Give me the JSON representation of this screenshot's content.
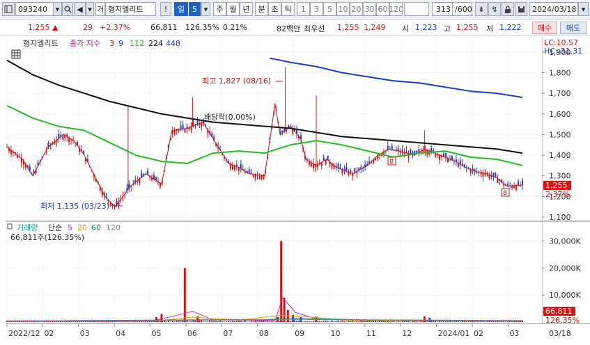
{
  "toolbar": {
    "code": "093240",
    "stock_tag": "거",
    "stock_name": "형지엘리트",
    "period_label": "일",
    "period_value": "5",
    "tabs": [
      "주",
      "월",
      "년",
      "분",
      "초",
      "틱"
    ],
    "intervals": [
      "1",
      "3",
      "5",
      "10",
      "20",
      "30",
      "60",
      "120"
    ],
    "page_count": "313",
    "page_total": "/600",
    "date": "2024/03/18"
  },
  "quote": {
    "price": "1,255",
    "change": "29",
    "change_pct": "+2.37%",
    "volume": "66,811",
    "volume_ratio": "126.35%",
    "turnover": "0.21%",
    "amount": "82백만",
    "best_label": "최우선",
    "best_ask": "1,255",
    "best_bid": "1,249",
    "open_label": "시",
    "open": "1,223",
    "high_label": "고",
    "high": "1,255",
    "low_label": "저",
    "low": "1,222",
    "buy_label": "매수",
    "sell_label": "매도"
  },
  "price_panel": {
    "stock_name": "형지엘리트",
    "ma_label": "종가 지수",
    "ma_periods": [
      "3",
      "9",
      "112",
      "224",
      "448"
    ],
    "ma_colors": [
      "#d01010",
      "#1a3cd0",
      "#20c020",
      "#101010",
      "#1a3cd0"
    ],
    "lc": "LC:10.57",
    "hc": "HC:-31.31",
    "high_annotation": "최고 1,827 (08/16)",
    "low_annotation": "최저 1,135 (03/23)",
    "dividend_annotation": "배당락(0.00%)",
    "price_tag": "1,255",
    "pct_tag": "2.37%",
    "ticks": [
      "1,900",
      "1,800",
      "1,700",
      "1,600",
      "1,500",
      "1,400",
      "1,300",
      "1,200",
      "1,100"
    ]
  },
  "volume_panel": {
    "title": "거래량",
    "ma_label": "단순",
    "ma_periods": [
      "5",
      "20",
      "60",
      "120"
    ],
    "ma_colors": [
      "#d020c0",
      "#e0a000",
      "#008060",
      "#808080"
    ],
    "summary": "66,811주(126.35%)",
    "ticks": [
      "30,000K",
      "20,000K",
      "10,000K"
    ],
    "volume_tag": "66,811",
    "pct_tag": "126.35%"
  },
  "x_axis": {
    "labels": [
      "2022/12",
      "02",
      "03",
      "04",
      "05",
      "06",
      "07",
      "08",
      "09",
      "10",
      "11",
      "12",
      "2024/01",
      "02",
      "03"
    ],
    "right_label": "03/18"
  },
  "chart_data": {
    "type": "line",
    "title": "형지엘리트",
    "x": [
      "2022/12",
      "02",
      "03",
      "04",
      "05",
      "06",
      "07",
      "08",
      "09",
      "10",
      "11",
      "12",
      "2024/01",
      "02",
      "03"
    ],
    "ylim": [
      1100,
      1950
    ],
    "series": [
      {
        "name": "3",
        "x_frac": [
          0.0,
          0.03,
          0.05,
          0.08,
          0.11,
          0.13,
          0.15,
          0.19,
          0.21,
          0.24,
          0.27,
          0.3,
          0.32,
          0.35,
          0.38,
          0.4,
          0.43,
          0.45,
          0.47,
          0.5,
          0.52,
          0.53,
          0.55,
          0.57,
          0.58,
          0.6,
          0.62,
          0.64,
          0.67,
          0.7,
          0.72,
          0.74,
          0.76,
          0.79,
          0.81,
          0.83,
          0.85,
          0.87,
          0.89,
          0.91,
          0.93,
          0.95,
          0.97,
          1.0
        ],
        "values": [
          1440,
          1380,
          1300,
          1440,
          1500,
          1470,
          1400,
          1200,
          1150,
          1250,
          1310,
          1260,
          1520,
          1530,
          1560,
          1480,
          1360,
          1340,
          1310,
          1300,
          1650,
          1500,
          1540,
          1480,
          1380,
          1350,
          1380,
          1340,
          1310,
          1350,
          1400,
          1430,
          1420,
          1400,
          1430,
          1410,
          1390,
          1370,
          1340,
          1320,
          1310,
          1290,
          1250,
          1255
        ]
      },
      {
        "name": "112",
        "x_frac": [
          0.0,
          0.05,
          0.1,
          0.15,
          0.2,
          0.25,
          0.3,
          0.35,
          0.4,
          0.45,
          0.5,
          0.55,
          0.6,
          0.65,
          0.7,
          0.75,
          0.8,
          0.85,
          0.9,
          0.95,
          1.0
        ],
        "values": [
          1640,
          1580,
          1540,
          1520,
          1460,
          1400,
          1370,
          1360,
          1410,
          1420,
          1410,
          1450,
          1470,
          1450,
          1420,
          1390,
          1410,
          1420,
          1390,
          1380,
          1350
        ]
      },
      {
        "name": "224",
        "x_frac": [
          0.0,
          0.05,
          0.1,
          0.15,
          0.2,
          0.25,
          0.3,
          0.35,
          0.4,
          0.45,
          0.5,
          0.55,
          0.6,
          0.65,
          0.7,
          0.75,
          0.8,
          0.85,
          0.9,
          0.95,
          1.0
        ],
        "values": [
          1860,
          1790,
          1740,
          1700,
          1660,
          1630,
          1600,
          1580,
          1560,
          1550,
          1540,
          1530,
          1510,
          1490,
          1480,
          1470,
          1460,
          1450,
          1440,
          1430,
          1410
        ]
      },
      {
        "name": "448",
        "x_frac": [
          0.51,
          0.55,
          0.6,
          0.65,
          0.7,
          0.75,
          0.8,
          0.85,
          0.9,
          0.95,
          1.0
        ],
        "values": [
          1870,
          1850,
          1830,
          1800,
          1780,
          1760,
          1750,
          1730,
          1710,
          1700,
          1680
        ]
      }
    ]
  }
}
